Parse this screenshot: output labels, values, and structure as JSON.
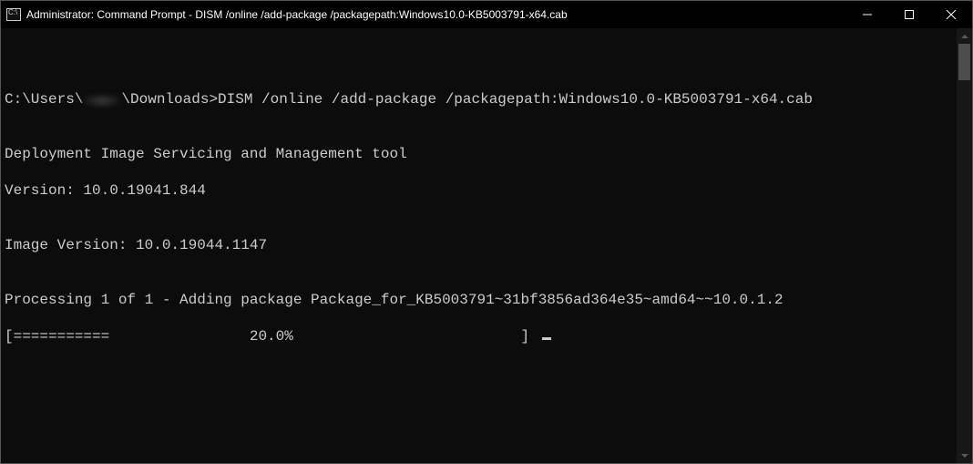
{
  "window": {
    "title": "Administrator: Command Prompt - DISM  /online /add-package /packagepath:Windows10.0-KB5003791-x64.cab"
  },
  "terminal": {
    "prompt_prefix": "C:\\Users\\",
    "prompt_suffix": "\\Downloads>",
    "command": "DISM /online /add-package /packagepath:Windows10.0-KB5003791-x64.cab",
    "blank1": "",
    "tool_line": "Deployment Image Servicing and Management tool",
    "version_line": "Version: 10.0.19041.844",
    "blank2": "",
    "image_version_line": "Image Version: 10.0.19044.1147",
    "blank3": "",
    "processing_line": "Processing 1 of 1 - Adding package Package_for_KB5003791~31bf3856ad364e35~amd64~~10.0.1.2",
    "progress_line": "[===========                20.0%                          ] "
  }
}
